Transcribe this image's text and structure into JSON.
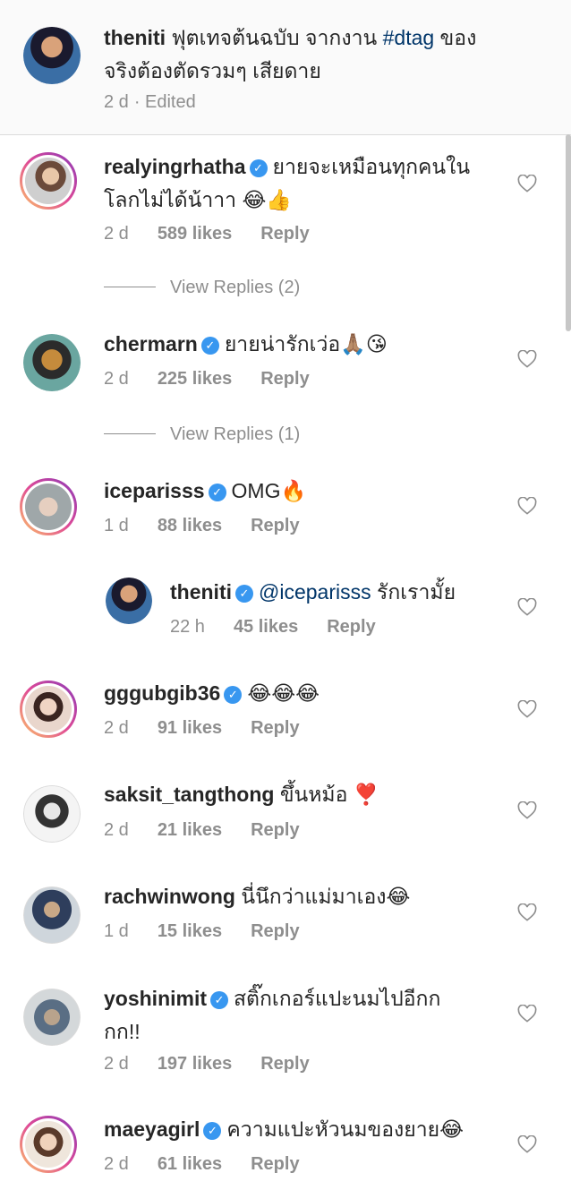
{
  "caption": {
    "username": "theniti",
    "text_line1": "ฟุตเทจต้นฉบับ จากงาน ",
    "hashtag": "#dtag",
    "text_line1_end": " ของ",
    "text_line2": "จริงต้องตัดรวมๆ เสียดาย",
    "time": "2 d",
    "edited": "· Edited"
  },
  "comments": [
    {
      "username": "realyingrhatha",
      "text": "ยายจะเหมือนทุกคนใน",
      "text2": "โลกไม่ได้น้าาา 😂👍",
      "time": "2 d",
      "likes": "589 likes",
      "reply": "Reply"
    },
    {
      "username": "chermarn",
      "text": "ยายน่ารักเว่อ🙏🏽😘",
      "time": "2 d",
      "likes": "225 likes",
      "reply": "Reply"
    },
    {
      "username": "iceparis s",
      "username_fixed": "iceparis s"
    },
    {
      "username": "gggubgib36",
      "text": "😂😂😂",
      "time": "2 d",
      "likes": "91 likes",
      "reply": "Reply"
    },
    {
      "username": "saksit_tangthong",
      "text": "ขึ้นหม้อ ❣️",
      "time": "2 d",
      "likes": "21 likes",
      "reply": "Reply"
    },
    {
      "username": "rachwinwong",
      "text": "นี่นึกว่าแม่มาเอง😂",
      "time": "1 d",
      "likes": "15 likes",
      "reply": "Reply"
    },
    {
      "username": "yoshinimit",
      "text": "สติ๊กเกอร์แปะนมไปอีกก",
      "text2": "กก!!",
      "time": "2 d",
      "likes": "197 likes",
      "reply": "Reply"
    },
    {
      "username": "maeyagirl",
      "text": "ความแปะหัวนมของยาย😂",
      "time": "2 d",
      "likes": "61 likes",
      "reply": "Reply"
    }
  ],
  "ice": {
    "username": "iceparisss",
    "text": "OMG🔥",
    "time": "1 d",
    "likes": "88 likes",
    "reply": "Reply"
  },
  "reply_item": {
    "username": "theniti",
    "mention": "@iceparisss",
    "text": " รักเรามั้ย",
    "time": "22 h",
    "likes": "45 likes",
    "reply": "Reply"
  },
  "view_replies": [
    "View Replies (2)",
    "View Replies (1)"
  ],
  "colors": {
    "link": "#003569",
    "verified": "#3897f0",
    "meta": "#8e8e8e"
  }
}
